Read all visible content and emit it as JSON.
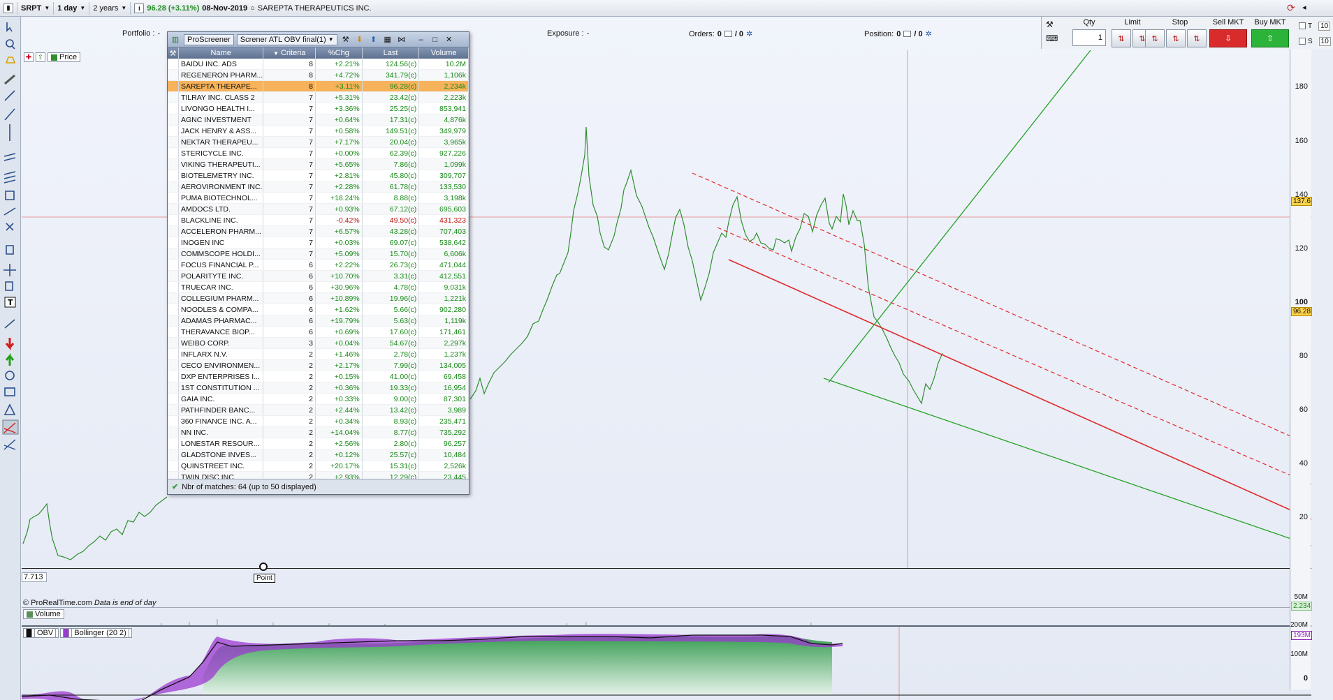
{
  "toolbar": {
    "ticker": "SRPT",
    "timeframe": "1 day",
    "range": "2 years",
    "price_change": "96.28 (+3.11%)",
    "date": "08-Nov-2019",
    "company": "SAREPTA THERAPEUTICS INC."
  },
  "info": {
    "portfolio_label": "Portfolio :",
    "portfolio_value": "-",
    "exposure_label": "Exposure :",
    "exposure_value": "-",
    "orders_label": "Orders:",
    "orders_a": "0",
    "orders_b": "/ 0",
    "position_label": "Position:",
    "position_a": "0",
    "position_b": "/ 0"
  },
  "order_panel": {
    "qty_label": "Qty",
    "qty_value": "1",
    "limit_label": "Limit",
    "stop_label": "Stop",
    "sell_label": "Sell MKT",
    "buy_label": "Buy MKT",
    "check_t": "T",
    "check_s": "S",
    "field_1": "10",
    "field_2": "10"
  },
  "price_pane": {
    "label": "Price",
    "low_value": "7.713",
    "point_label": "Point",
    "copyright": "© ProRealTime.com",
    "data_note": "Data is end of day"
  },
  "y_axis": {
    "ticks": [
      "180",
      "160",
      "140",
      "120",
      "100",
      "80",
      "60",
      "40",
      "20"
    ],
    "crosshair_value": "137.6",
    "last_value": "96.28",
    "vol_scale": "50M",
    "vol_value": "2.234",
    "obv_scale_1": "200M",
    "obv_value": "193M",
    "obv_scale_2": "100M",
    "obv_zero": "0"
  },
  "volume_pane": {
    "label": "Volume"
  },
  "obv_pane": {
    "obv_label": "OBV",
    "boll_label": "Bollinger (20 2)"
  },
  "colors": {
    "up": "#1f8b1f",
    "down": "#c01515",
    "selected_row": "#f7b35b",
    "red_line": "#e02a2a",
    "green_line": "#25a325"
  },
  "screener": {
    "title": "ProScreener",
    "screener_name": "Screner ATL OBV final(1)",
    "columns": [
      "Name",
      "Criteria",
      "%Chg",
      "Last",
      "Volume"
    ],
    "footer": "Nbr of matches: 64 (up to 50 displayed)",
    "rows": [
      {
        "name": "BAIDU INC. ADS",
        "criteria": "8",
        "chg": "+2.21%",
        "last": "124.56(c)",
        "volume": "10.2M"
      },
      {
        "name": "REGENERON PHARM...",
        "criteria": "8",
        "chg": "+4.72%",
        "last": "341.79(c)",
        "volume": "1,106k"
      },
      {
        "name": "SAREPTA THERAPE...",
        "criteria": "8",
        "chg": "+3.11%",
        "last": "96.28(c)",
        "volume": "2,234k"
      },
      {
        "name": "TILRAY INC. CLASS 2",
        "criteria": "7",
        "chg": "+5.31%",
        "last": "23.42(c)",
        "volume": "2,223k"
      },
      {
        "name": "LIVONGO HEALTH I...",
        "criteria": "7",
        "chg": "+3.36%",
        "last": "25.25(c)",
        "volume": "853,941"
      },
      {
        "name": "AGNC INVESTMENT",
        "criteria": "7",
        "chg": "+0.64%",
        "last": "17.31(c)",
        "volume": "4,876k"
      },
      {
        "name": "JACK HENRY & ASS...",
        "criteria": "7",
        "chg": "+0.58%",
        "last": "149.51(c)",
        "volume": "349,979"
      },
      {
        "name": "NEKTAR THERAPEU...",
        "criteria": "7",
        "chg": "+7.17%",
        "last": "20.04(c)",
        "volume": "3,965k"
      },
      {
        "name": "STERICYCLE INC.",
        "criteria": "7",
        "chg": "+0.00%",
        "last": "62.39(c)",
        "volume": "927,226"
      },
      {
        "name": "VIKING THERAPEUTI...",
        "criteria": "7",
        "chg": "+5.65%",
        "last": "7.86(c)",
        "volume": "1,099k"
      },
      {
        "name": "BIOTELEMETRY INC.",
        "criteria": "7",
        "chg": "+2.81%",
        "last": "45.80(c)",
        "volume": "309,707"
      },
      {
        "name": "AEROVIRONMENT INC.",
        "criteria": "7",
        "chg": "+2.28%",
        "last": "61.78(c)",
        "volume": "133,530"
      },
      {
        "name": "PUMA BIOTECHNOL...",
        "criteria": "7",
        "chg": "+18.24%",
        "last": "8.88(c)",
        "volume": "3,198k"
      },
      {
        "name": "AMDOCS LTD.",
        "criteria": "7",
        "chg": "+0.93%",
        "last": "67.12(c)",
        "volume": "695,603"
      },
      {
        "name": "BLACKLINE INC.",
        "criteria": "7",
        "chg": "-0.42%",
        "last": "49.50(c)",
        "volume": "431,323"
      },
      {
        "name": "ACCELERON PHARM...",
        "criteria": "7",
        "chg": "+6.57%",
        "last": "43.28(c)",
        "volume": "707,403"
      },
      {
        "name": "INOGEN INC",
        "criteria": "7",
        "chg": "+0.03%",
        "last": "69.07(c)",
        "volume": "538,642"
      },
      {
        "name": "COMMSCOPE HOLDI...",
        "criteria": "7",
        "chg": "+5.09%",
        "last": "15.70(c)",
        "volume": "6,606k"
      },
      {
        "name": "FOCUS FINANCIAL P...",
        "criteria": "6",
        "chg": "+2.22%",
        "last": "26.73(c)",
        "volume": "471,044"
      },
      {
        "name": "POLARITYTE INC.",
        "criteria": "6",
        "chg": "+10.70%",
        "last": "3.31(c)",
        "volume": "412,551"
      },
      {
        "name": "TRUECAR INC.",
        "criteria": "6",
        "chg": "+30.96%",
        "last": "4.78(c)",
        "volume": "9,031k"
      },
      {
        "name": "COLLEGIUM PHARM...",
        "criteria": "6",
        "chg": "+10.89%",
        "last": "19.96(c)",
        "volume": "1,221k"
      },
      {
        "name": "NOODLES & COMPA...",
        "criteria": "6",
        "chg": "+1.62%",
        "last": "5.66(c)",
        "volume": "902,280"
      },
      {
        "name": "ADAMAS PHARMAC...",
        "criteria": "6",
        "chg": "+19.79%",
        "last": "5.63(c)",
        "volume": "1,119k"
      },
      {
        "name": "THERAVANCE BIOP...",
        "criteria": "6",
        "chg": "+0.69%",
        "last": "17.60(c)",
        "volume": "171,461"
      },
      {
        "name": "WEIBO CORP.",
        "criteria": "3",
        "chg": "+0.04%",
        "last": "54.67(c)",
        "volume": "2,297k"
      },
      {
        "name": "INFLARX N.V.",
        "criteria": "2",
        "chg": "+1.46%",
        "last": "2.78(c)",
        "volume": "1,237k"
      },
      {
        "name": "CECO ENVIRONMEN...",
        "criteria": "2",
        "chg": "+2.17%",
        "last": "7.99(c)",
        "volume": "134,005"
      },
      {
        "name": "DXP ENTERPRISES I...",
        "criteria": "2",
        "chg": "+0.15%",
        "last": "41.00(c)",
        "volume": "69,458"
      },
      {
        "name": "1ST CONSTITUTION ...",
        "criteria": "2",
        "chg": "+0.36%",
        "last": "19.33(c)",
        "volume": "16,954"
      },
      {
        "name": "GAIA INC.",
        "criteria": "2",
        "chg": "+0.33%",
        "last": "9.00(c)",
        "volume": "87,301"
      },
      {
        "name": "PATHFINDER BANC...",
        "criteria": "2",
        "chg": "+2.44%",
        "last": "13.42(c)",
        "volume": "3,989"
      },
      {
        "name": "360 FINANCE INC. A...",
        "criteria": "2",
        "chg": "+0.34%",
        "last": "8.93(c)",
        "volume": "235,471"
      },
      {
        "name": "NN INC.",
        "criteria": "2",
        "chg": "+14.04%",
        "last": "8.77(c)",
        "volume": "735,292"
      },
      {
        "name": "LONESTAR RESOUR...",
        "criteria": "2",
        "chg": "+2.56%",
        "last": "2.80(c)",
        "volume": "96,257"
      },
      {
        "name": "GLADSTONE INVES...",
        "criteria": "2",
        "chg": "+0.12%",
        "last": "25.57(c)",
        "volume": "10,484"
      },
      {
        "name": "QUINSTREET INC.",
        "criteria": "2",
        "chg": "+20.17%",
        "last": "15.31(c)",
        "volume": "2,526k"
      },
      {
        "name": "TWIN DISC INC",
        "criteria": "2",
        "chg": "+2.93%",
        "last": "12.29(c)",
        "volume": "23,445"
      }
    ]
  }
}
